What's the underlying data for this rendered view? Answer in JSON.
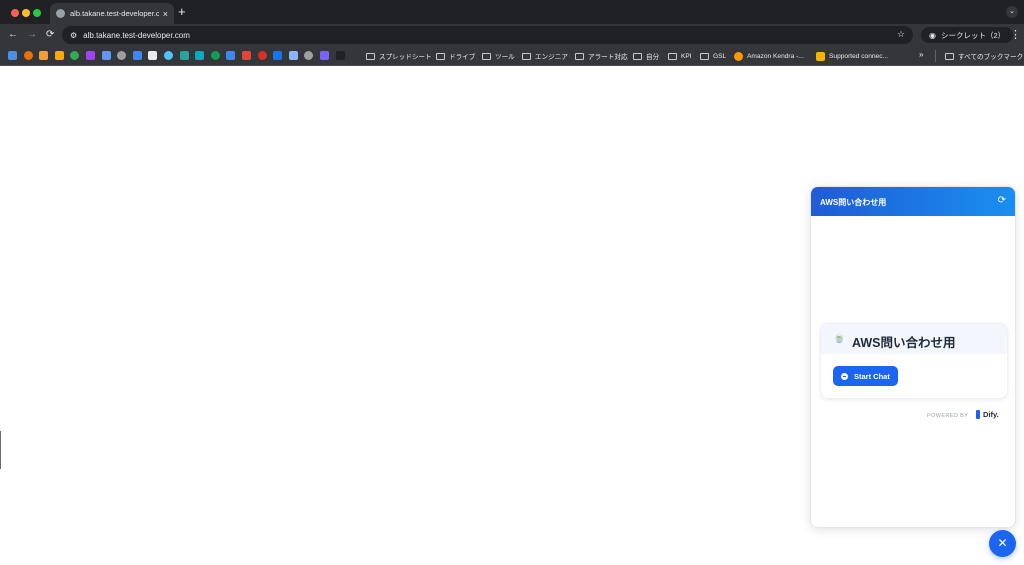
{
  "browser": {
    "tab": {
      "title": "alb.takane.test-developer.co",
      "close_glyph": "×"
    },
    "new_tab_glyph": "+",
    "tab_search_glyph": "⌄",
    "toolbar": {
      "back_glyph": "←",
      "forward_glyph": "→",
      "reload_glyph": "⟳",
      "site_info_glyph": "⚙",
      "url": "alb.takane.test-developer.com",
      "star_glyph": "☆",
      "incognito_label": "シークレット（2）",
      "incognito_glyph": "◉",
      "menu_glyph": "⋮"
    },
    "bookmarks": {
      "icon_colors": [
        "#4a90e2",
        "#e8710a",
        "#f29d38",
        "#f9ab00",
        "#34a853",
        "#a142f4",
        "#5e97f6",
        "#9aa0a6",
        "#4285f4",
        "#e8eaed",
        "#4fc3f7",
        "#26a69a",
        "#00acc1",
        "#0f9d58",
        "#4285f4",
        "#ea4335",
        "#d93025",
        "#1a73e8",
        "#8ab4f8",
        "#9aa0a6",
        "#7b61ff",
        "#202124"
      ],
      "folders": [
        {
          "label": "スプレッドシート"
        },
        {
          "label": "ドライブ"
        },
        {
          "label": "ツール"
        },
        {
          "label": "エンジニア"
        },
        {
          "label": "アラート対応"
        },
        {
          "label": "自分"
        },
        {
          "label": "KPI"
        },
        {
          "label": "GSL"
        }
      ],
      "links": [
        {
          "label": "Amazon Kendra -..."
        },
        {
          "label": "Supported connec..."
        }
      ],
      "overflow_glyph": "»",
      "all_bookmarks_label": "すべてのブックマーク"
    }
  },
  "chat_widget": {
    "header_title": "AWS問い合わせ用",
    "refresh_glyph": "⟳",
    "app_icon": "🍵",
    "app_title": "AWS問い合わせ用",
    "start_button_label": "Start Chat",
    "powered_by_label": "POWERED BY",
    "brand_name": "Dify."
  },
  "fab": {
    "glyph": "✕"
  },
  "colors": {
    "accent": "#1c64f2",
    "header_gradient_start": "#1f5cd6",
    "header_gradient_end": "#1a8ff0",
    "chrome_dark": "#202124",
    "chrome_toolbar": "#35363a"
  }
}
